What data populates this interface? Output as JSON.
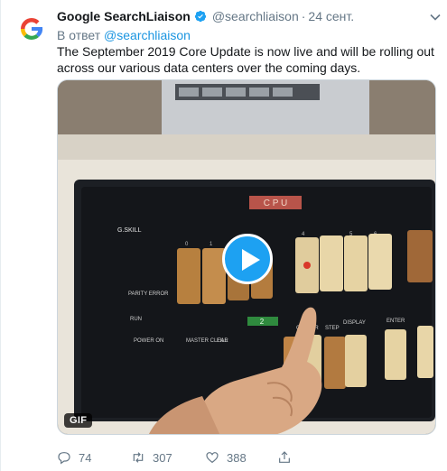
{
  "author": {
    "name": "Google SearchLiaison",
    "handle": "@searchliaison",
    "separator": "·",
    "timestamp": "24 сент.",
    "avatar_icon": "google-g-logo",
    "verified_icon": "verified-badge-icon"
  },
  "reply": {
    "prefix": "В ответ",
    "link": "@searchliaison"
  },
  "tweet": {
    "text": "The September 2019 Core Update is now live and will be rolling out across our various data centers over the coming days."
  },
  "media": {
    "type_badge": "GIF",
    "play_icon": "play-icon",
    "panel_texts": {
      "cpu": "C P U",
      "brand": "G.SKILL",
      "parity": "PARITY ERROR",
      "run": "RUN",
      "power": "POWER ON",
      "master": "MASTER CLEAR",
      "fill": "FILL",
      "center": "CENTER",
      "step": "STEP",
      "display": "DISPLAY",
      "enter": "ENTER",
      "green_label": "2",
      "bits": [
        "0",
        "1",
        "4",
        "5",
        "6"
      ]
    }
  },
  "actions": {
    "replies": "74",
    "retweets": "307",
    "likes": "388"
  },
  "colors": {
    "accent": "#1da1f2",
    "link": "#1b95e0",
    "muted": "#657786"
  }
}
